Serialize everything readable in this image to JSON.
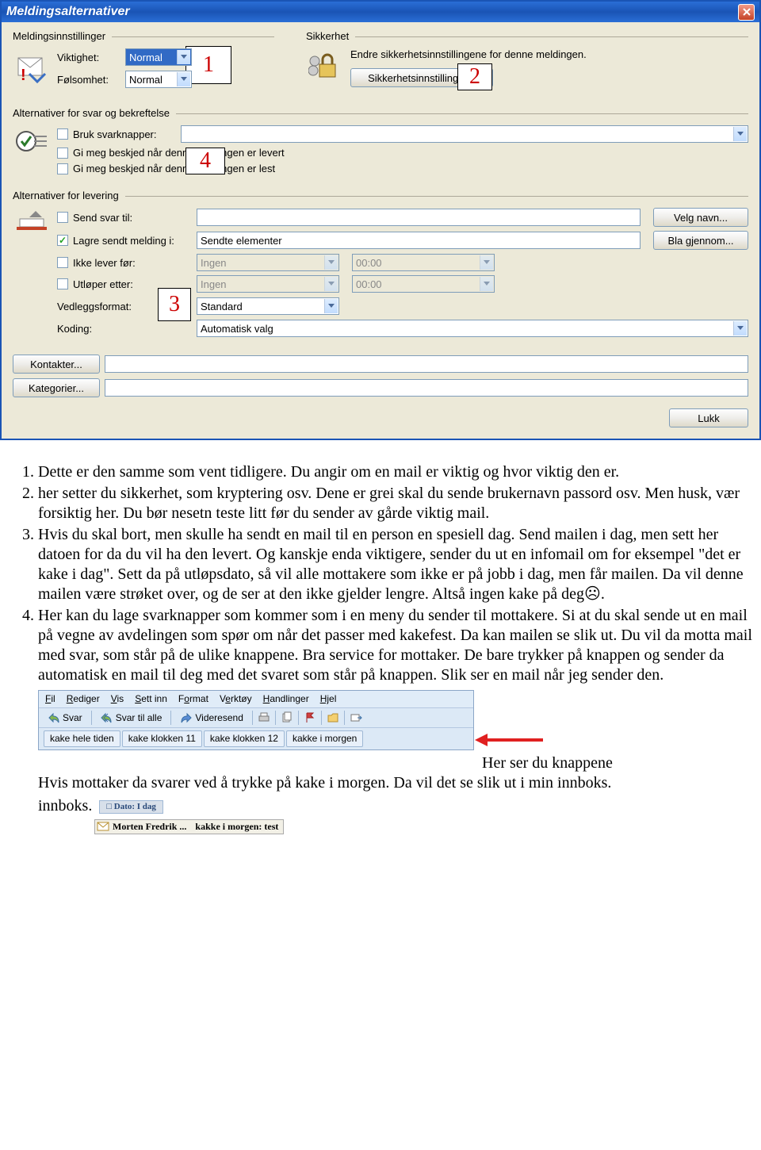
{
  "dialog": {
    "title": "Meldingsalternativer",
    "close_icon": "close",
    "groups": {
      "settings": {
        "label": "Meldingsinnstillinger",
        "importance_label": "Viktighet:",
        "importance_value": "Normal",
        "sensitivity_label": "Følsomhet:",
        "sensitivity_value": "Normal"
      },
      "security": {
        "label": "Sikkerhet",
        "desc": "Endre sikkerhetsinnstillingene for denne meldingen.",
        "button": "Sikkerhetsinnstillinger..."
      },
      "reply": {
        "label": "Alternativer for svar og bekreftelse",
        "use_buttons": "Bruk svarknapper:",
        "notify_delivered": "Gi meg beskjed når denne meldingen er levert",
        "notify_read": "Gi meg beskjed når denne meldingen er lest"
      },
      "delivery": {
        "label": "Alternativer for levering",
        "reply_to": "Send svar til:",
        "select_names": "Velg navn...",
        "save_in": "Lagre sendt melding i:",
        "save_in_value": "Sendte elementer",
        "browse": "Bla gjennom...",
        "deliver_after": "Ikke lever før:",
        "expires_after": "Utløper etter:",
        "none": "Ingen",
        "time": "00:00",
        "attach_format": "Vedleggsformat:",
        "attach_value": "Standard",
        "encoding": "Koding:",
        "encoding_value": "Automatisk valg"
      }
    },
    "contacts_btn": "Kontakter...",
    "categories_btn": "Kategorier...",
    "close_btn": "Lukk"
  },
  "annotations": {
    "a1": "1",
    "a2": "2",
    "a3": "3",
    "a4": "4"
  },
  "doc": {
    "item1": "Dette er den samme som vent tidligere. Du angir om en mail er viktig og hvor viktig den er.",
    "item2": "her setter du sikkerhet, som kryptering osv. Dene er grei skal du sende brukernavn passord osv. Men husk, vær forsiktig her. Du bør nesetn teste litt før du sender av gårde viktig mail.",
    "item3": "Hvis du skal bort, men skulle ha sendt en mail til en person en spesiell dag. Send mailen i dag, men sett her datoen for da du vil ha den levert. Og kanskje enda viktigere, sender du ut en infomail om for eksempel \"det er kake i dag\". Sett da på utløpsdato, så vil alle mottakere som ikke er på jobb i dag, men får mailen. Da vil denne mailen være strøket over, og de ser at den ikke gjelder lengre. Altså ingen kake på deg☹.",
    "item4": "Her kan du lage svarknapper som kommer som i en meny du sender til mottakere. Si at du skal sende ut en mail på vegne av avdelingen som spør om når det passer med kakefest. Da kan mailen se slik ut. Du vil da motta mail med svar, som står på de ulike knappene. Bra service for mottaker. De bare trykker på knappen og sender da automatisk en mail til deg med det svaret som står på knappen. Slik ser en mail når jeg sender den.",
    "after_mini": "Her ser du knappene",
    "after_mini2": "Hvis mottaker da svarer ved å trykke på kake i morgen. Da vil det se slik ut i min innboks.",
    "innboks_word": "innboks."
  },
  "mini": {
    "menu": {
      "fil": "Fil",
      "rediger": "Rediger",
      "vis": "Vis",
      "settinn": "Sett inn",
      "format": "Format",
      "verktoy": "Verktøy",
      "handlinger": "Handlinger",
      "hjelp": "Hjel"
    },
    "tb": {
      "svar": "Svar",
      "svaralle": "Svar til alle",
      "videresend": "Videresend"
    },
    "votes": {
      "v1": "kake hele tiden",
      "v2": "kake klokken 11",
      "v3": "kake klokken 12",
      "v4": "kakke i morgen"
    }
  },
  "inbox": {
    "date_header": "Dato: I dag",
    "from": "Morten Fredrik ...",
    "subject": "kakke i morgen: test"
  }
}
